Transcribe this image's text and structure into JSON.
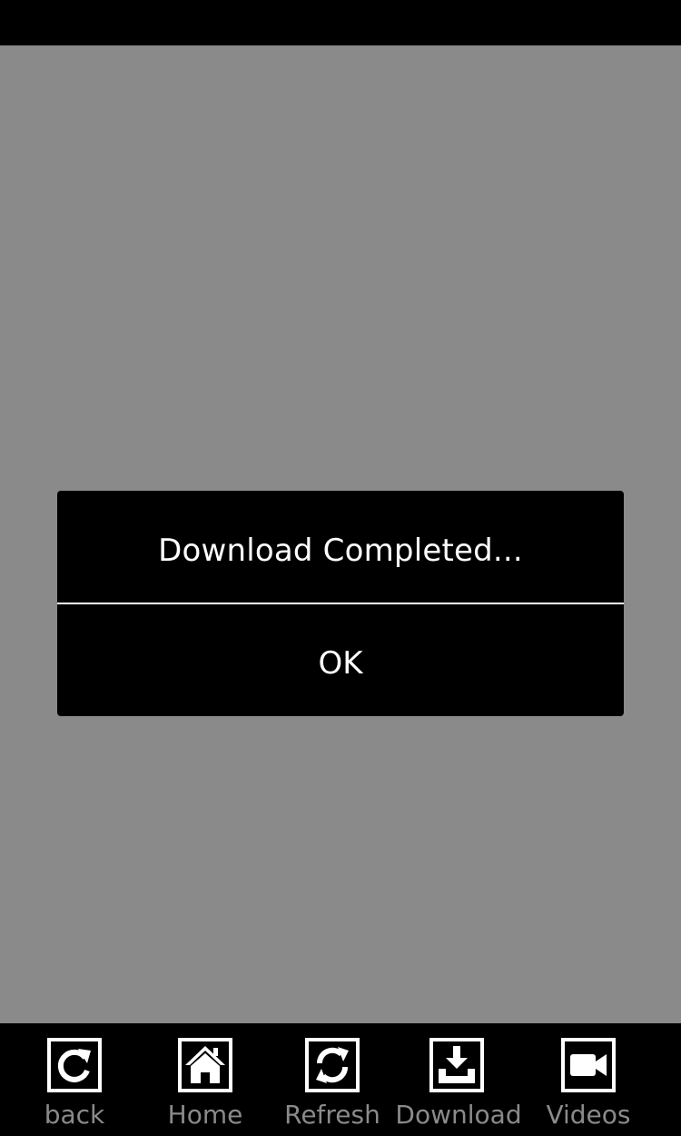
{
  "dialog": {
    "message": "Download Completed...",
    "ok_label": "OK"
  },
  "bottom_bar": {
    "items": [
      {
        "label": "back",
        "icon": "back-refresh-icon"
      },
      {
        "label": "Home",
        "icon": "home-icon"
      },
      {
        "label": "Refresh",
        "icon": "refresh-icon"
      },
      {
        "label": "Download",
        "icon": "download-icon"
      },
      {
        "label": "Videos",
        "icon": "video-camera-icon"
      }
    ]
  },
  "colors": {
    "background": "#8a8a8a",
    "bar": "#000000",
    "icon": "#ffffff",
    "label": "#8a8a8a"
  }
}
